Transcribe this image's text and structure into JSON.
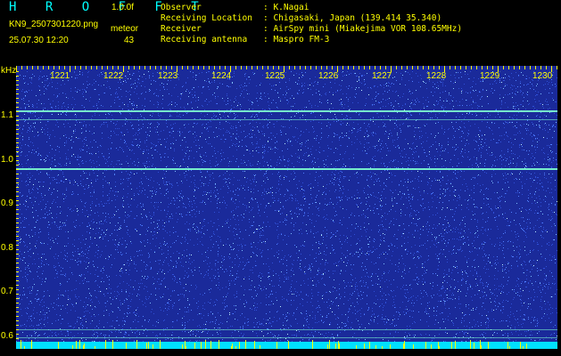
{
  "header": {
    "title": "H R O F F T",
    "version": "1.0.0f",
    "filename": "KN9_2507301220.png",
    "meteor_label": "meteor",
    "datetime": "25.07.30 12:20",
    "meteor_count": "43"
  },
  "info": [
    {
      "label": "Observer",
      "value": ": K.Nagai"
    },
    {
      "label": "Receiving Location",
      "value": ": Chigasaki, Japan (139.414 35.340)"
    },
    {
      "label": "Receiver",
      "value": ": AirSpy mini (Miakejima VOR 108.65MHz)"
    },
    {
      "label": "Receiving antenna",
      "value": ": Maspro FM-3"
    }
  ],
  "axis": {
    "y_unit": "kHz",
    "y_ticks": [
      "1.1",
      "1.0",
      "0.9",
      "0.8",
      "0.7",
      "0.6"
    ],
    "x_ticks": [
      "1221",
      "1222",
      "1223",
      "1224",
      "1225",
      "1226",
      "1227",
      "1228",
      "1229",
      "1230"
    ]
  },
  "spectrogram": {
    "background_color": "#1a2a9a",
    "noise_colors": [
      "#3050d8",
      "#5080ff",
      "#80c0ff",
      "#c0f0ff"
    ],
    "carrier_color": "#7fffd0",
    "bottom_band_color": "#00e0ff",
    "tick_color": "#ffff00"
  }
}
